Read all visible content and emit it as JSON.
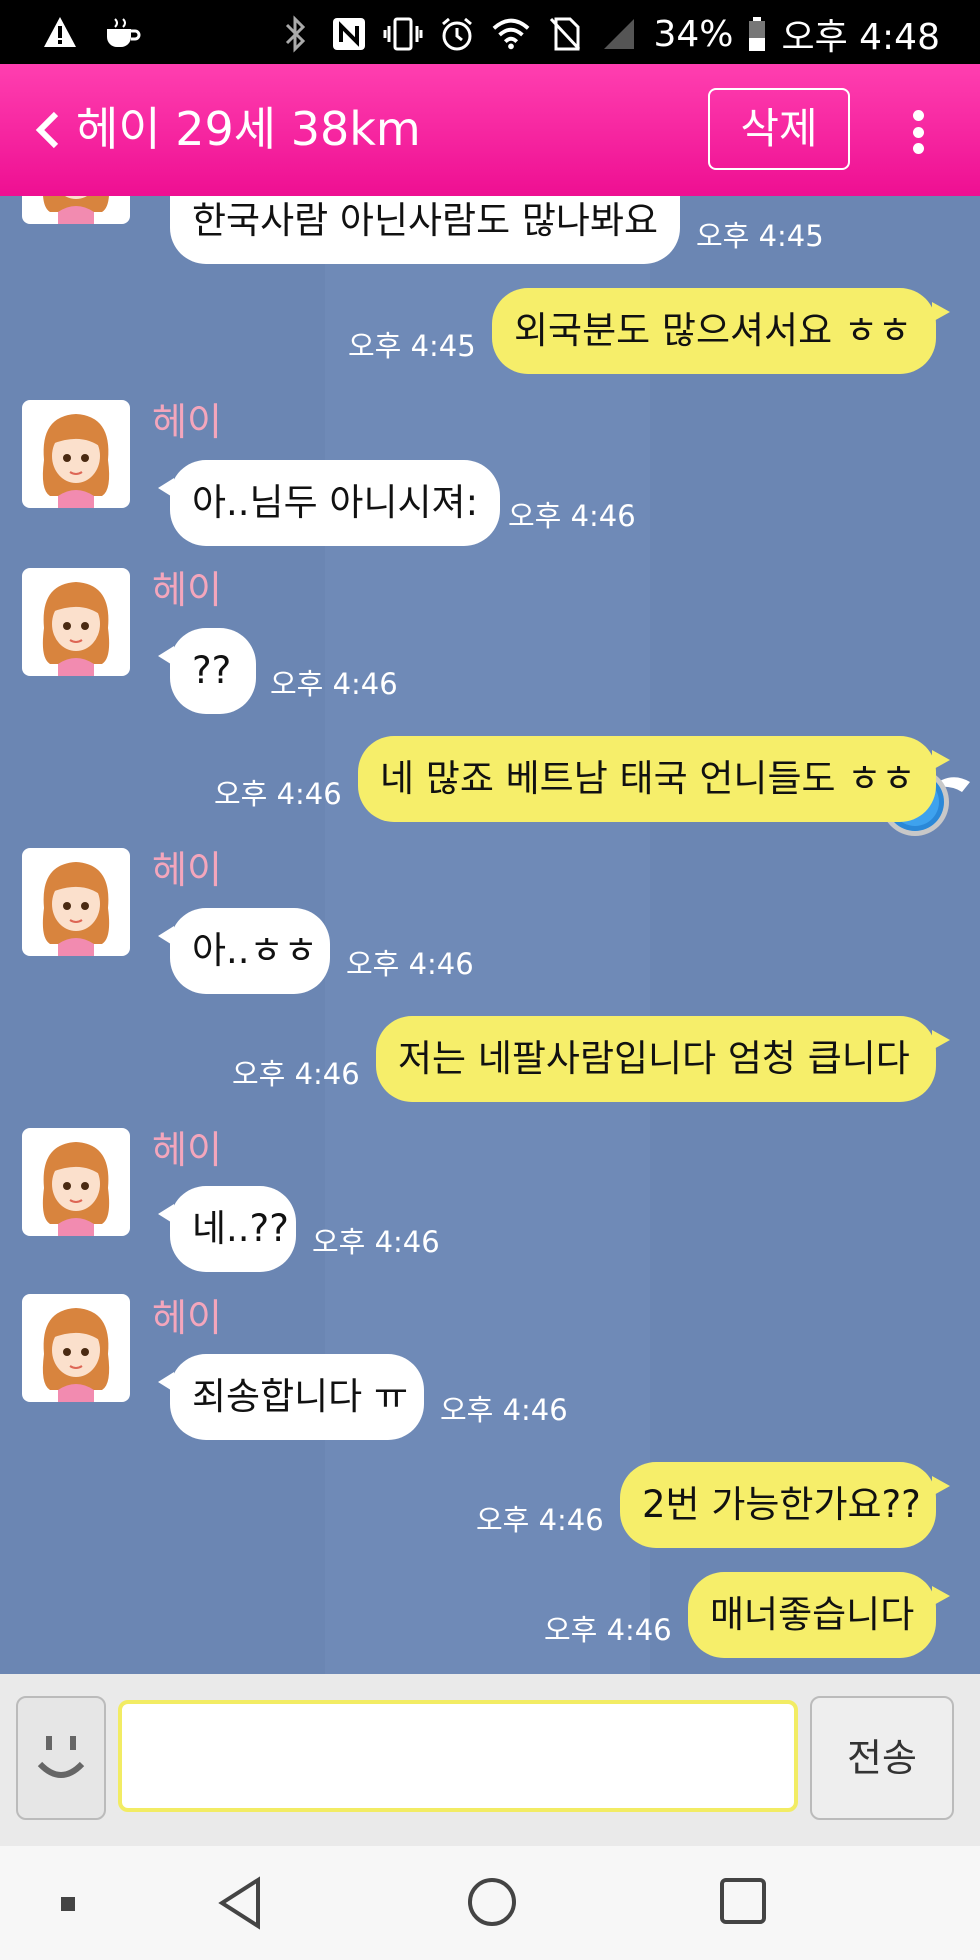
{
  "status_bar": {
    "battery_percent": "34%",
    "time": "오후 4:48",
    "left_icons": [
      "warning-icon",
      "coffee-icon"
    ],
    "right_icons": [
      "bluetooth-icon",
      "nfc-icon",
      "vibrate-icon",
      "alarm-icon",
      "wifi-icon",
      "no-sim-icon",
      "signal-icon",
      "battery-icon"
    ]
  },
  "header": {
    "title": "헤이 29세 38km",
    "delete_label": "삭제",
    "background": "#ee0f92"
  },
  "messages": [
    {
      "side": "in",
      "sender": "",
      "text": "한국사람 아닌사람도 많나봐요",
      "time": "오후 4:45"
    },
    {
      "side": "out",
      "text": "외국분도 많으셔서요 ㅎㅎ",
      "time": "오후 4:45"
    },
    {
      "side": "in",
      "sender": "헤이",
      "text": "아..님두 아니시져:",
      "time": "오후 4:46"
    },
    {
      "side": "in",
      "sender": "헤이",
      "text": "??",
      "time": "오후 4:46"
    },
    {
      "side": "out",
      "text": "네 많죠 베트남 태국 언니들도 ㅎㅎ",
      "time": "오후 4:46"
    },
    {
      "side": "in",
      "sender": "헤이",
      "text": "아..ㅎㅎ",
      "time": "오후 4:46"
    },
    {
      "side": "out",
      "text": "저는 네팔사람입니다 엄청 큽니다",
      "time": "오후 4:46"
    },
    {
      "side": "in",
      "sender": "헤이",
      "text": "네..??",
      "time": "오후 4:46"
    },
    {
      "side": "in",
      "sender": "헤이",
      "text": "죄송합니다 ㅠ",
      "time": "오후 4:46"
    },
    {
      "side": "out",
      "text": "2번 가능한가요??",
      "time": "오후 4:46"
    },
    {
      "side": "out",
      "text": "매너좋습니다",
      "time": "오후 4:46"
    }
  ],
  "composer": {
    "input_value": "",
    "send_label": "전송"
  },
  "colors": {
    "chat_background": "#6b86b3",
    "outgoing_bubble": "#f6ee6a",
    "incoming_bubble": "#ffffff",
    "sender_name": "#f4a6bc"
  }
}
